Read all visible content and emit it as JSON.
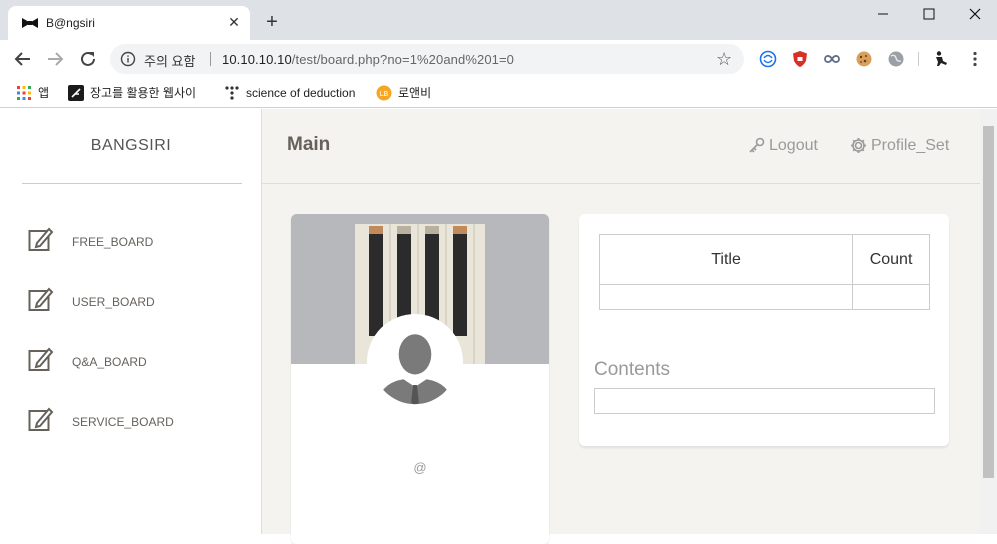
{
  "browser": {
    "tab_title": "B@ngsiri",
    "new_tab_symbol": "+",
    "close_symbol": "✕",
    "security_warning": "주의 요함",
    "url_host": "10.10.10.10",
    "url_rest": "/test/board.php?no=1%20and%201=0",
    "bookmarks": [
      {
        "label": "앱",
        "icon": "apps-grid-icon"
      },
      {
        "label": "장고를 활용한 웹사이",
        "icon": "feather-icon"
      },
      {
        "label": "science of deduction",
        "icon": "dots-icon"
      },
      {
        "label": "로앤비",
        "icon": "lawnb-icon"
      }
    ]
  },
  "sidebar": {
    "brand": "BANGSIRI",
    "items": [
      {
        "label": "FREE_BOARD",
        "icon": "edit-icon"
      },
      {
        "label": "USER_BOARD",
        "icon": "edit-icon"
      },
      {
        "label": "Q&A_BOARD",
        "icon": "edit-icon"
      },
      {
        "label": "SERVICE_BOARD",
        "icon": "edit-icon"
      }
    ]
  },
  "header": {
    "title": "Main",
    "logout_label": "Logout",
    "profile_label": "Profile_Set"
  },
  "profile": {
    "handle": "@"
  },
  "board": {
    "columns": [
      "Title",
      "Count"
    ],
    "rows": [
      [
        "",
        ""
      ]
    ],
    "contents_label": "Contents",
    "contents_value": ""
  },
  "colors": {
    "page_bg": "#f4f3ef",
    "text_muted": "#9a9a9a",
    "text_nav": "#66615b"
  }
}
